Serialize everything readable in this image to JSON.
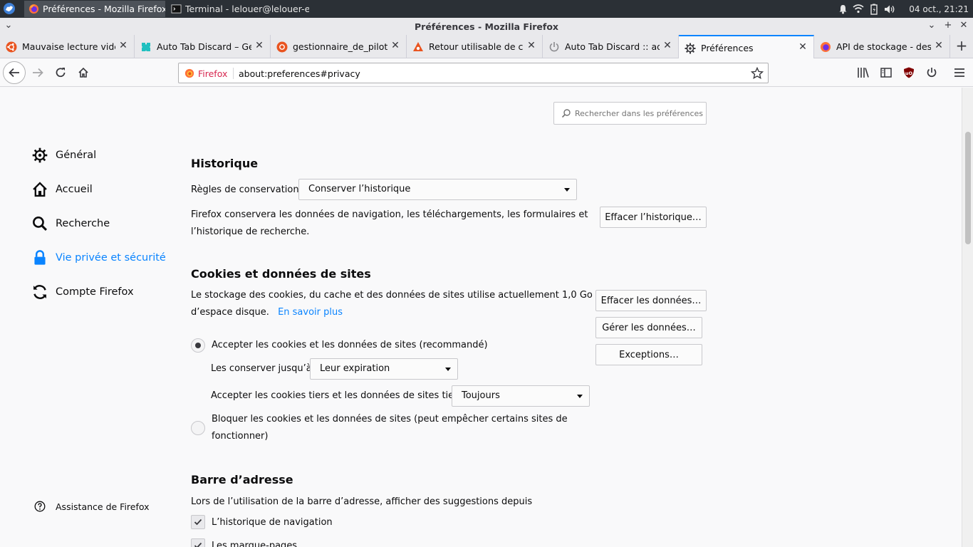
{
  "panel": {
    "tasks": [
      {
        "label": "Préférences - Mozilla Firefox"
      },
      {
        "label": "Terminal - lelouer@lelouer-e..."
      }
    ],
    "clock": "04 oct., 21:21"
  },
  "window": {
    "title": "Préférences - Mozilla Firefox"
  },
  "tabs": [
    {
      "label": "Mauvaise lecture video"
    },
    {
      "label": "Auto Tab Discard – Get"
    },
    {
      "label": "gestionnaire_de_pilotes"
    },
    {
      "label": "Retour utilisable de con"
    },
    {
      "label": "Auto Tab Discard :: add"
    },
    {
      "label": "Préférences"
    },
    {
      "label": "API de stockage - des s"
    }
  ],
  "urlbar": {
    "identity": "Firefox",
    "url": "about:preferences#privacy"
  },
  "search": {
    "placeholder": "Rechercher dans les préférences"
  },
  "sidebar": {
    "items": [
      {
        "label": "Général"
      },
      {
        "label": "Accueil"
      },
      {
        "label": "Recherche"
      },
      {
        "label": "Vie privée et sécurité"
      },
      {
        "label": "Compte Firefox"
      }
    ],
    "help": "Assistance de Firefox"
  },
  "history": {
    "heading": "Historique",
    "rules_label": "Règles de conservation",
    "rules_value": "Conserver l’historique",
    "desc_line1": "Firefox conservera les données de navigation, les téléchargements, les formulaires et",
    "desc_line2": "l’historique de recherche.",
    "clear_button": "Effacer l’historique…"
  },
  "cookies": {
    "heading": "Cookies et données de sites",
    "desc_line1": "Le stockage des cookies, du cache et des données de sites utilise actuellement 1,0 Go",
    "desc_line2": "d’espace disque.",
    "learn_more": "En savoir plus",
    "clear_button": "Effacer les données…",
    "manage_button": "Gérer les données…",
    "exceptions_button": "Exceptions…",
    "accept_label": "Accepter les cookies et les données de sites (recommandé)",
    "keep_label": "Les conserver jusqu’à",
    "keep_value": "Leur expiration",
    "third_party_label": "Accepter les cookies tiers et les données de sites tiers",
    "third_party_value": "Toujours",
    "block_line1": "Bloquer les cookies et les données de sites (peut empêcher certains sites de",
    "block_line2": "fonctionner)"
  },
  "addressbar": {
    "heading": "Barre d’adresse",
    "desc": "Lors de l’utilisation de la barre d’adresse, afficher des suggestions depuis",
    "history_option": "L’historique de navigation",
    "bookmarks_option": "Les marque-pages"
  }
}
